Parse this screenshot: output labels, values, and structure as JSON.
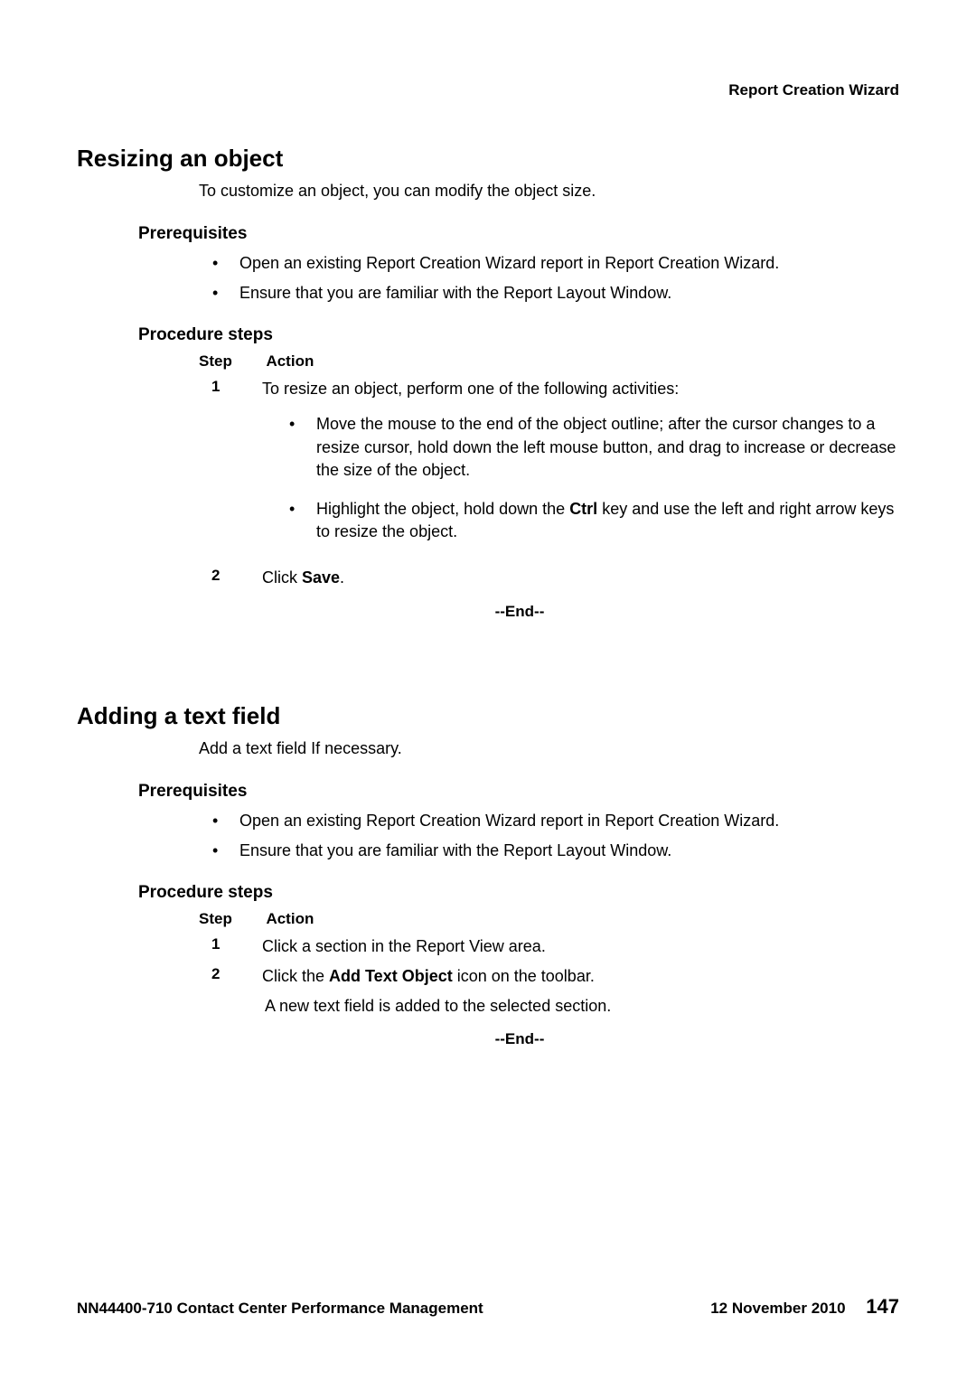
{
  "header": {
    "right": "Report Creation Wizard"
  },
  "sections": [
    {
      "title": "Resizing an object",
      "intro": "To customize an object, you can modify the object size.",
      "prereq_title": "Prerequisites",
      "prereqs": [
        "Open an existing Report Creation Wizard report in Report Creation Wizard.",
        "Ensure that you are familiar with the Report Layout Window."
      ],
      "procedure_title": "Procedure steps",
      "step_label": "Step",
      "action_label": "Action",
      "steps": [
        {
          "num": "1",
          "action": "To resize an object, perform one of the following activities:",
          "sub_bullets": [
            {
              "pre": "Move the mouse to the end of the object outline; after the cursor changes to a resize cursor, hold down the left mouse button, and drag to increase or decrease the size of the object."
            },
            {
              "pre": "Highlight the object, hold down the ",
              "bold": "Ctrl",
              "post": " key and use the left and right arrow keys to resize the object."
            }
          ]
        },
        {
          "num": "2",
          "action_pre": "Click ",
          "action_bold": "Save",
          "action_post": "."
        }
      ],
      "end": "--End--"
    },
    {
      "title": "Adding a text field",
      "intro": "Add a text field If necessary.",
      "prereq_title": "Prerequisites",
      "prereqs": [
        "Open an existing Report Creation Wizard report in Report Creation Wizard.",
        "Ensure that you are familiar with the Report Layout Window."
      ],
      "procedure_title": "Procedure steps",
      "step_label": "Step",
      "action_label": "Action",
      "steps": [
        {
          "num": "1",
          "action": "Click a section in the Report View area."
        },
        {
          "num": "2",
          "action_pre": "Click the ",
          "action_bold": "Add Text Object",
          "action_post": " icon on the toolbar.",
          "result": "A new text field is added to the selected section."
        }
      ],
      "end": "--End--"
    }
  ],
  "footer": {
    "left": "NN44400-710 Contact Center Performance Management",
    "date": "12 November 2010",
    "page": "147"
  }
}
